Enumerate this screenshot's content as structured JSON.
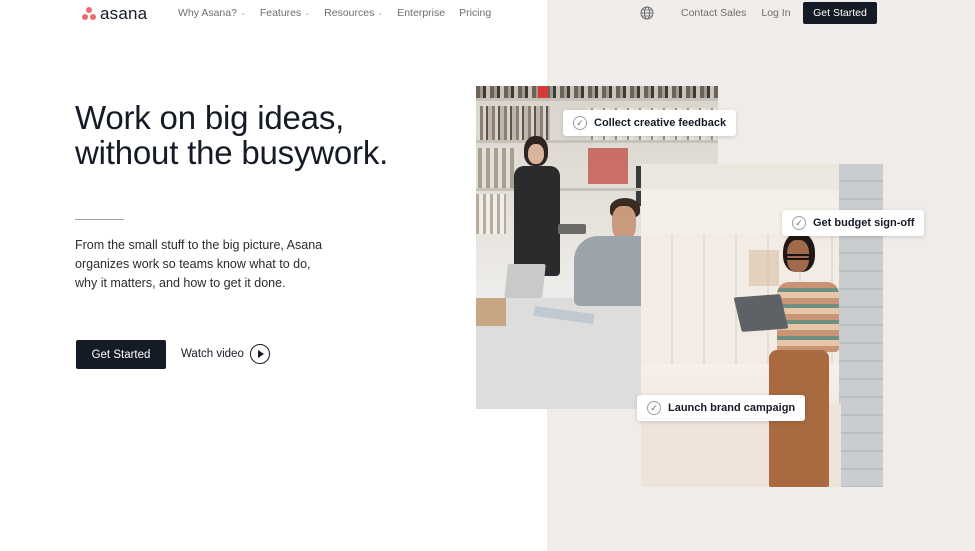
{
  "brand": {
    "name": "asana",
    "accent": "#f06a6a"
  },
  "nav": {
    "links": [
      {
        "label": "Why Asana?",
        "dropdown": true
      },
      {
        "label": "Features",
        "dropdown": true
      },
      {
        "label": "Resources",
        "dropdown": true
      },
      {
        "label": "Enterprise",
        "dropdown": false
      },
      {
        "label": "Pricing",
        "dropdown": false
      }
    ],
    "globe_icon": "globe-icon",
    "contact_sales": "Contact Sales",
    "log_in": "Log In",
    "cta": "Get Started"
  },
  "hero": {
    "title_lines": [
      "Work on big ideas,",
      "without the busywork."
    ],
    "description_lines": [
      "From the small stuff to the big picture, Asana",
      "organizes work so teams know what to do,",
      "why it matters, and how to get it done."
    ],
    "primary_cta": "Get Started",
    "watch_video": "Watch video"
  },
  "tasks": [
    "Collect creative feedback",
    "Get budget sign-off",
    "Launch brand campaign"
  ],
  "colors": {
    "dark": "#151b26",
    "panel_bg": "#efecea",
    "muted_text": "#6d6e6f"
  }
}
